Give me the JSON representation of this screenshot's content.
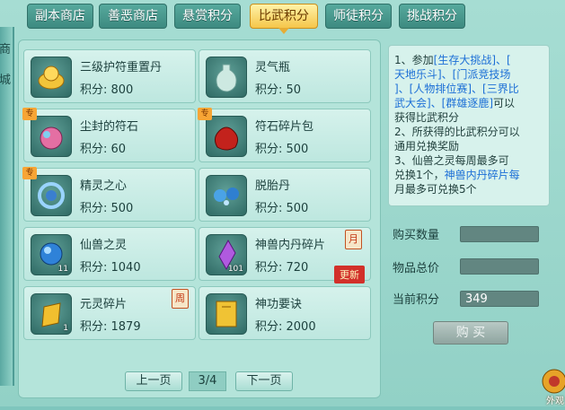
{
  "tabs": [
    {
      "label": "副本商店",
      "active": false
    },
    {
      "label": "善恶商店",
      "active": false
    },
    {
      "label": "悬赏积分",
      "active": false
    },
    {
      "label": "比武积分",
      "active": true
    },
    {
      "label": "师徒积分",
      "active": false
    },
    {
      "label": "挑战积分",
      "active": false
    }
  ],
  "side_strip": [
    "商",
    "城"
  ],
  "items": [
    {
      "name": "三级护符重置丹",
      "points": "积分: 800",
      "icon": "gold-ingot-icon"
    },
    {
      "name": "灵气瓶",
      "points": "积分: 50",
      "icon": "vase-icon"
    },
    {
      "name": "尘封的符石",
      "points": "积分: 60",
      "icon": "rune-stone-icon",
      "tag": "专"
    },
    {
      "name": "符石碎片包",
      "points": "积分: 500",
      "icon": "red-pouch-icon",
      "tag": "专"
    },
    {
      "name": "精灵之心",
      "points": "积分: 500",
      "icon": "spirit-heart-icon",
      "tag": "专"
    },
    {
      "name": "脱胎丹",
      "points": "积分: 500",
      "icon": "blue-pill-icon"
    },
    {
      "name": "仙兽之灵",
      "points": "积分: 1040",
      "icon": "blue-orb-icon",
      "count": "11"
    },
    {
      "name": "神兽内丹碎片",
      "points": "积分: 720",
      "icon": "purple-crystal-icon",
      "count": "101",
      "badge": "月",
      "ribbon": "更新"
    },
    {
      "name": "元灵碎片",
      "points": "积分: 1879",
      "icon": "gold-shard-icon",
      "count": "1",
      "badge": "周"
    },
    {
      "name": "神功要诀",
      "points": "积分: 2000",
      "icon": "book-icon"
    }
  ],
  "pager": {
    "prev": "上一页",
    "page": "3/4",
    "next": "下一页"
  },
  "info": {
    "line1_a": "1、参加",
    "line1_b": "[生存大挑战]、[",
    "line2": "天地乐斗]、[门派竞技场",
    "line3": "]、[人物排位赛]、[三界比",
    "line4_a": "武大会]、[群雄逐鹿]",
    "line4_b": "可以",
    "line5": "获得比武积分",
    "line6": "2、所获得的比武积分可以",
    "line7": "通用兑换奖励",
    "line8": "3、仙兽之灵每周最多可",
    "line9_a": "兑换1个，",
    "line9_b": "神兽内丹碎片每",
    "line10": "月最多可兑换5个"
  },
  "form": {
    "qty_label": "购买数量",
    "qty_value": "",
    "total_label": "物品总价",
    "total_value": "",
    "current_label": "当前积分",
    "current_value": "349",
    "buy_label": "购 买"
  },
  "corner_label": "外观",
  "colors": {
    "active_tab": "#f5c64a",
    "highlight_text": "#1c6fd6",
    "badge_red": "#d2302a"
  }
}
